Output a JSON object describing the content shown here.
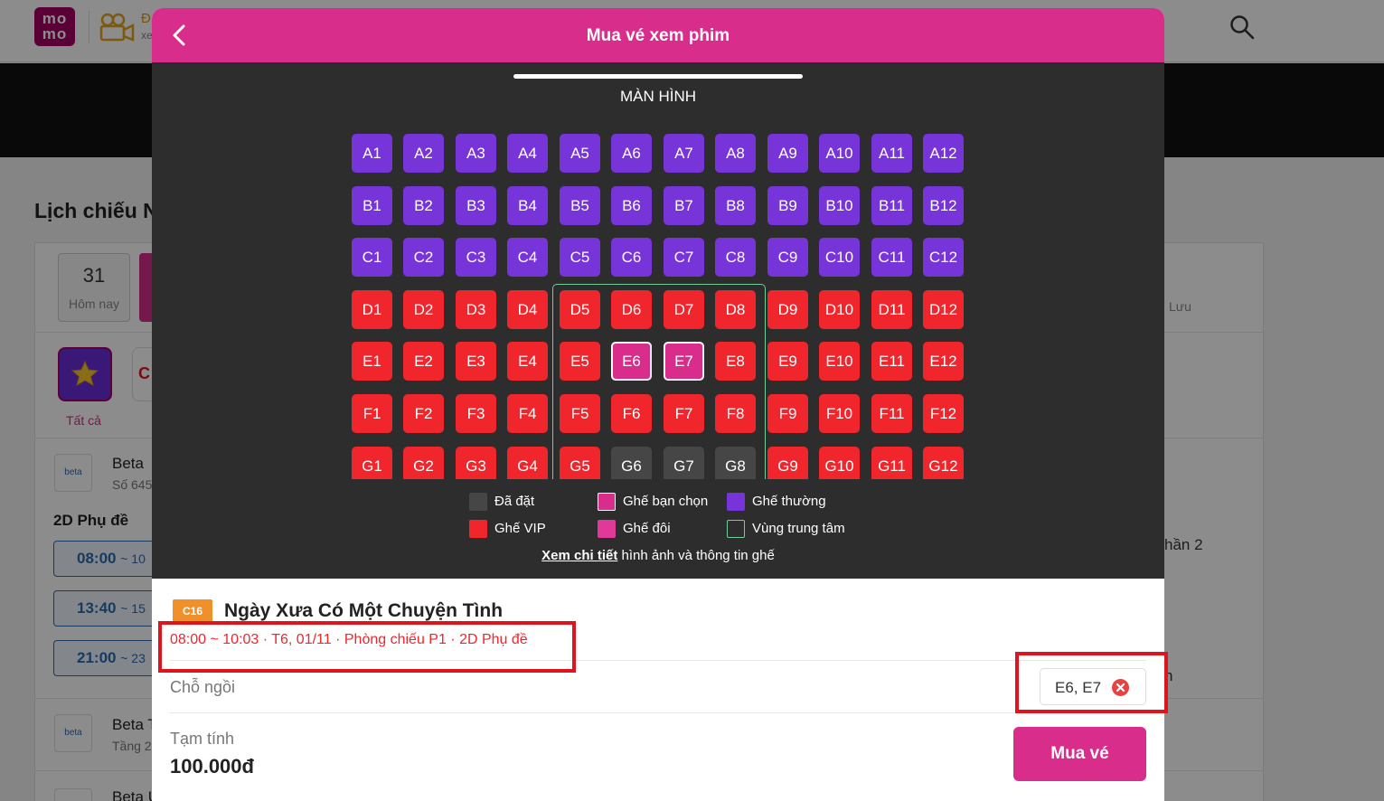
{
  "background": {
    "logo_text": "mo\nmo",
    "header_title": "Đ",
    "header_sub": "xe",
    "page_title": "Lịch chiếu N",
    "date": {
      "day": "31",
      "label": "Hôm nay"
    },
    "filter_all_label": "Tất cả",
    "filter_2_label": "C",
    "cinemas": [
      {
        "logo": "beta",
        "name": "Beta",
        "address": "Số 645"
      },
      {
        "logo": "beta",
        "name": "Beta T",
        "address": "Tầng 2"
      },
      {
        "logo": "beta",
        "name": "Beta Ung Văn Khiêm",
        "address": ""
      }
    ],
    "format": "2D Phụ đề",
    "times": [
      {
        "start": "08:00",
        "end": "~ 10"
      },
      {
        "start": "13:40",
        "end": "~ 15"
      },
      {
        "start": "21:00",
        "end": "~ 23"
      }
    ],
    "right_texts": [
      "Lưu",
      "hần 2",
      "n"
    ]
  },
  "modal": {
    "title": "Mua vé xem phim",
    "screen_label": "MÀN HÌNH",
    "rows": [
      {
        "row": "A",
        "seats": [
          "normal",
          "normal",
          "normal",
          "normal",
          "normal",
          "normal",
          "normal",
          "normal",
          "normal",
          "normal",
          "normal",
          "normal"
        ]
      },
      {
        "row": "B",
        "seats": [
          "normal",
          "normal",
          "normal",
          "normal",
          "normal",
          "normal",
          "normal",
          "normal",
          "normal",
          "normal",
          "normal",
          "normal"
        ]
      },
      {
        "row": "C",
        "seats": [
          "normal",
          "normal",
          "normal",
          "normal",
          "normal",
          "normal",
          "normal",
          "normal",
          "normal",
          "normal",
          "normal",
          "normal"
        ]
      },
      {
        "row": "D",
        "seats": [
          "vip",
          "vip",
          "vip",
          "vip",
          "vip",
          "vip",
          "vip",
          "vip",
          "vip",
          "vip",
          "vip",
          "vip"
        ]
      },
      {
        "row": "E",
        "seats": [
          "vip",
          "vip",
          "vip",
          "vip",
          "vip",
          "selected",
          "selected",
          "vip",
          "vip",
          "vip",
          "vip",
          "vip"
        ]
      },
      {
        "row": "F",
        "seats": [
          "vip",
          "vip",
          "vip",
          "vip",
          "vip",
          "vip",
          "vip",
          "vip",
          "vip",
          "vip",
          "vip",
          "vip"
        ]
      },
      {
        "row": "G",
        "seats": [
          "vip",
          "vip",
          "vip",
          "vip",
          "vip",
          "booked",
          "booked",
          "booked",
          "vip",
          "vip",
          "vip",
          "vip"
        ]
      }
    ],
    "legend": [
      {
        "label": "Đã đặt",
        "color": "#464646"
      },
      {
        "label": "Ghế bạn chọn",
        "color": "#d82d8b"
      },
      {
        "label": "Ghế thường",
        "color": "#7634d9"
      },
      {
        "label": "Ghế VIP",
        "color": "#f0262c"
      },
      {
        "label": "Ghế đôi",
        "color": "#e0399a"
      },
      {
        "label": "Vùng trung tâm",
        "color": "outline"
      }
    ],
    "detail_link": "Xem chi tiết",
    "detail_text": "hình ảnh và thông tin ghế",
    "age_rating": "C16",
    "movie_title": "Ngày Xưa Có Một Chuyện Tình",
    "showtime_info": "08:00 ~ 10:03 · T6, 01/11 · Phòng chiếu P1 · 2D Phụ đề",
    "seat_label": "Chỗ ngồi",
    "selected_seats": "E6, E7",
    "subtotal_label": "Tạm tính",
    "subtotal_value": "100.000đ",
    "buy_button": "Mua vé"
  },
  "colors": {
    "brand": "#d82d8b",
    "normal_seat": "#7634d9",
    "vip_seat": "#f0262c",
    "booked_seat": "#464646",
    "center_zone": "#6fcf97"
  }
}
